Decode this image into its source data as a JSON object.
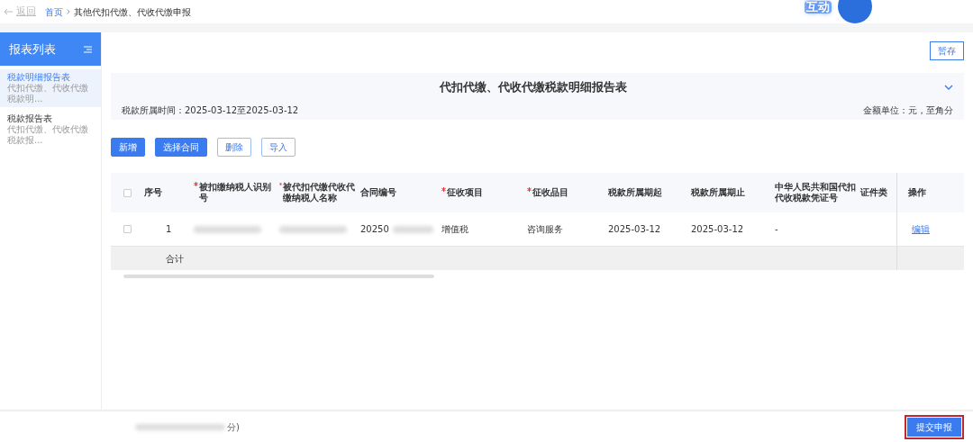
{
  "topbar": {
    "back": "返回",
    "breadcrumb": [
      {
        "label": "首页",
        "link": true
      },
      {
        "label": "其他代扣代缴、代收代缴申报",
        "link": false
      }
    ],
    "badge": "互动"
  },
  "sidebar": {
    "title": "报表列表",
    "items": [
      {
        "title": "税款明细报告表",
        "subtitle": "代扣代缴、代收代缴税款明...",
        "selected": true
      },
      {
        "title": "税款报告表",
        "subtitle": "代扣代缴、代收代缴税款报...",
        "selected": false
      }
    ]
  },
  "save_button": "暂存",
  "report": {
    "title": "代扣代缴、代收代缴税款明细报告表",
    "period": "税款所属时间：2025-03-12至2025-03-12",
    "unit": "金额单位：元，至角分",
    "expanded": false
  },
  "toolbar": [
    {
      "label": "新增",
      "kind": "primary"
    },
    {
      "label": "选择合同",
      "kind": "primary"
    },
    {
      "label": "删除",
      "kind": "outline"
    },
    {
      "label": "导入",
      "kind": "outline"
    }
  ],
  "table": {
    "columns": [
      {
        "label": "序号",
        "required": false
      },
      {
        "label": "被扣缴纳税人识别号",
        "required": true
      },
      {
        "label": "被代扣代缴代收代缴纳税人名称",
        "required": true
      },
      {
        "label": "合同编号",
        "required": false
      },
      {
        "label": "征收项目",
        "required": true
      },
      {
        "label": "征收品目",
        "required": true
      },
      {
        "label": "税款所属期起",
        "required": false
      },
      {
        "label": "税款所属期止",
        "required": false
      },
      {
        "label": "中华人民共和国代扣代收税款凭证号",
        "required": false
      },
      {
        "label": "证件类",
        "required": false
      },
      {
        "label": "操作",
        "required": false
      }
    ],
    "all_checked": false,
    "rows": [
      {
        "checked": false,
        "cells": [
          "1",
          "",
          "",
          "20250",
          "增值税",
          "咨询服务",
          "2025-03-12",
          "2025-03-12",
          "-",
          ""
        ],
        "action": "编辑"
      }
    ],
    "total_label": "合计"
  },
  "footer": {
    "note": "分)",
    "submit": "提交申报"
  }
}
